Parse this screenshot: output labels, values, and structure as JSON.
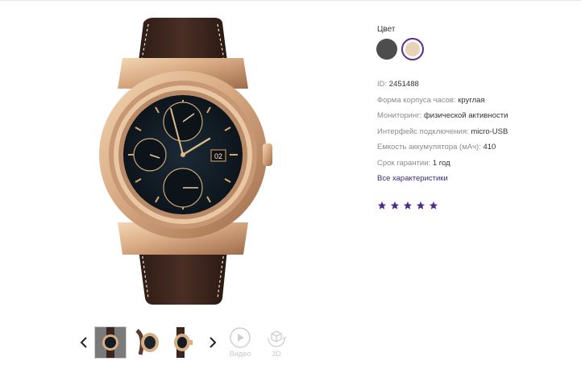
{
  "product": {
    "color_label": "Цвет",
    "colors": [
      {
        "name": "dark-gray",
        "hex": "#4d4d4d"
      },
      {
        "name": "gold",
        "hex": "#e9d3b6",
        "selected": true
      }
    ],
    "specs": [
      {
        "label": "ID:",
        "value": "2451488"
      },
      {
        "label": "Форма корпуса часов:",
        "value": "круглая"
      },
      {
        "label": "Мониторинг:",
        "value": "физической активности"
      },
      {
        "label": "Интерфейс подключения:",
        "value": "micro-USB"
      },
      {
        "label": "Емкость аккумулятора (мАч):",
        "value": "410"
      },
      {
        "label": "Срок гарантии:",
        "value": "1 год"
      }
    ],
    "all_specs_link": "Все характеристики",
    "rating": 5,
    "accent": "#4b2a8a"
  },
  "gallery": {
    "watch_date": "02",
    "video_label": "Видео",
    "threed_label": "3D",
    "prev_icon": "chevron-left-icon",
    "next_icon": "chevron-right-icon"
  }
}
